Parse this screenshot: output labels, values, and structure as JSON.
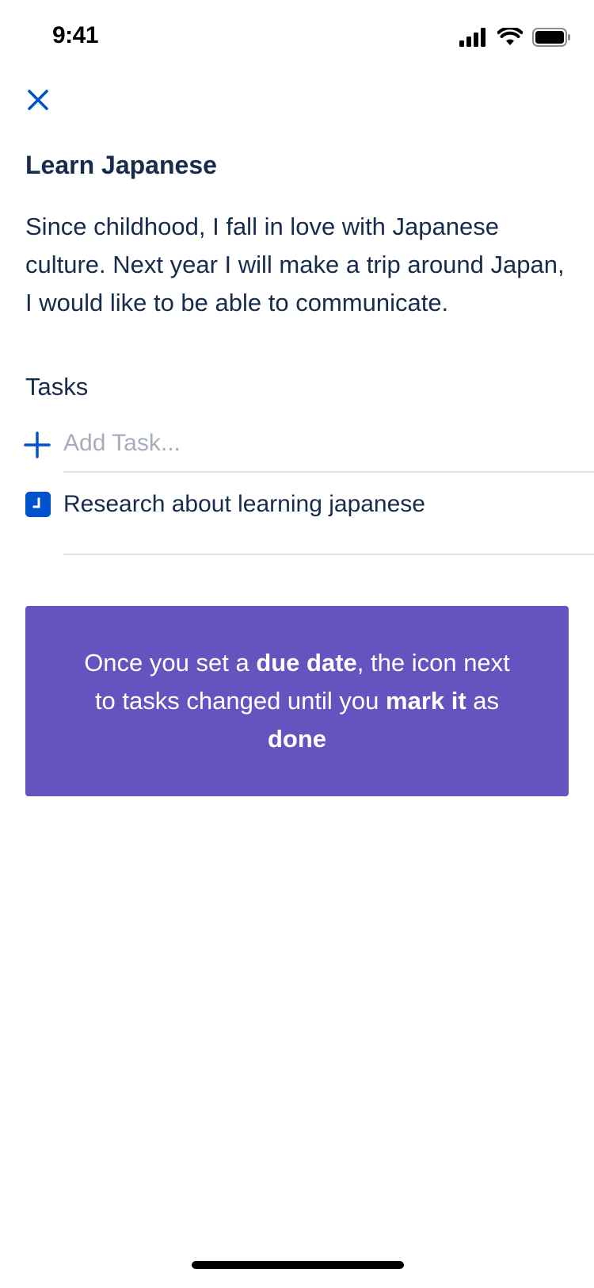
{
  "status_bar": {
    "time": "9:41",
    "icons": [
      "cellular-signal-icon",
      "wifi-icon",
      "battery-icon"
    ]
  },
  "header": {
    "close_icon": "close-icon"
  },
  "goal": {
    "title": "Learn Japanese",
    "description": "Since childhood, I fall in love with Japanese culture. Next year I will make a trip around Japan, I would like to be able to communicate."
  },
  "tasks": {
    "heading": "Tasks",
    "add_placeholder": "Add Task...",
    "add_icon": "plus-icon",
    "items": [
      {
        "label": "Research about learning japanese",
        "icon": "clock-icon"
      }
    ]
  },
  "banner": {
    "parts": [
      {
        "text": "Once you set a ",
        "bold": false
      },
      {
        "text": "due date",
        "bold": true
      },
      {
        "text": ", the icon next to tasks changed until you ",
        "bold": false
      },
      {
        "text": "mark it",
        "bold": true
      },
      {
        "text": " as ",
        "bold": false
      },
      {
        "text": "done",
        "bold": true
      }
    ]
  },
  "colors": {
    "primary_text": "#172B4D",
    "accent_blue": "#0052CC",
    "banner_purple": "#6554C0",
    "placeholder": "#A5ADBA",
    "divider": "#DFE1E6"
  }
}
